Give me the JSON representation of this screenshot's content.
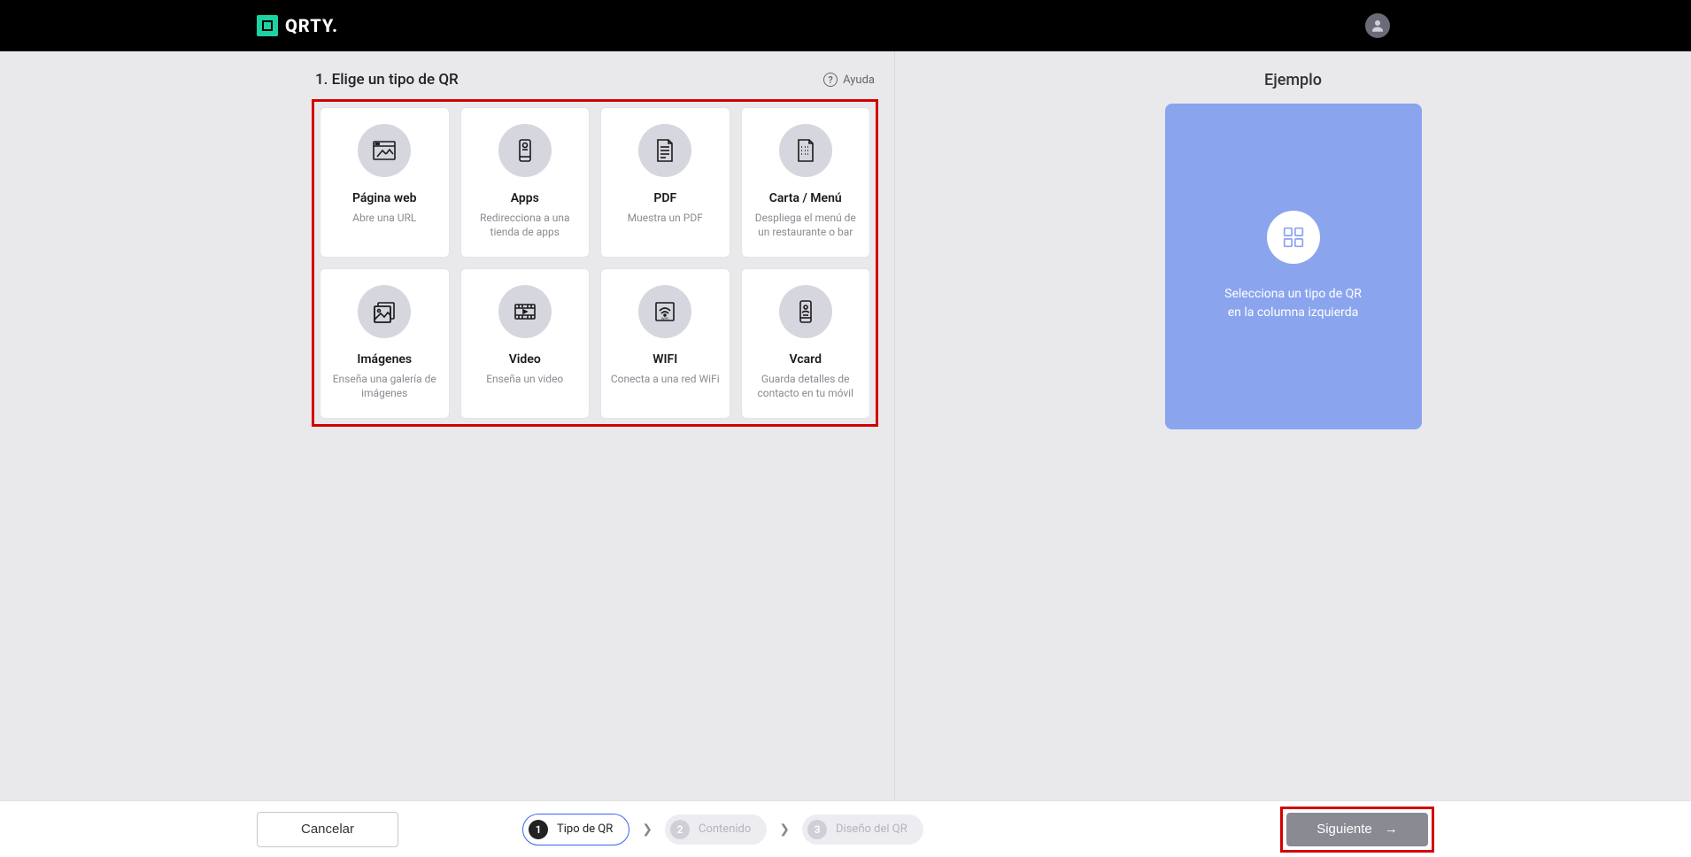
{
  "header": {
    "brand": "QRTY."
  },
  "section": {
    "title": "1. Elige un tipo de QR",
    "help_label": "Ayuda"
  },
  "cards": [
    {
      "title": "Página web",
      "desc": "Abre una URL"
    },
    {
      "title": "Apps",
      "desc": "Redirecciona a una tienda de apps"
    },
    {
      "title": "PDF",
      "desc": "Muestra un PDF"
    },
    {
      "title": "Carta / Menú",
      "desc": "Despliega el menú de un restaurante o bar"
    },
    {
      "title": "Imágenes",
      "desc": "Enseña una galería de imágenes"
    },
    {
      "title": "Video",
      "desc": "Enseña un video"
    },
    {
      "title": "WIFI",
      "desc": "Conecta a una red WiFi"
    },
    {
      "title": "Vcard",
      "desc": "Guarda detalles de contacto en tu móvil"
    }
  ],
  "example": {
    "heading": "Ejemplo",
    "line1": "Selecciona un tipo de QR",
    "line2": "en la columna izquierda"
  },
  "footer": {
    "cancel": "Cancelar",
    "next": "Siguiente",
    "steps": [
      {
        "num": "1",
        "label": "Tipo de QR"
      },
      {
        "num": "2",
        "label": "Contenido"
      },
      {
        "num": "3",
        "label": "Diseño del QR"
      }
    ]
  }
}
